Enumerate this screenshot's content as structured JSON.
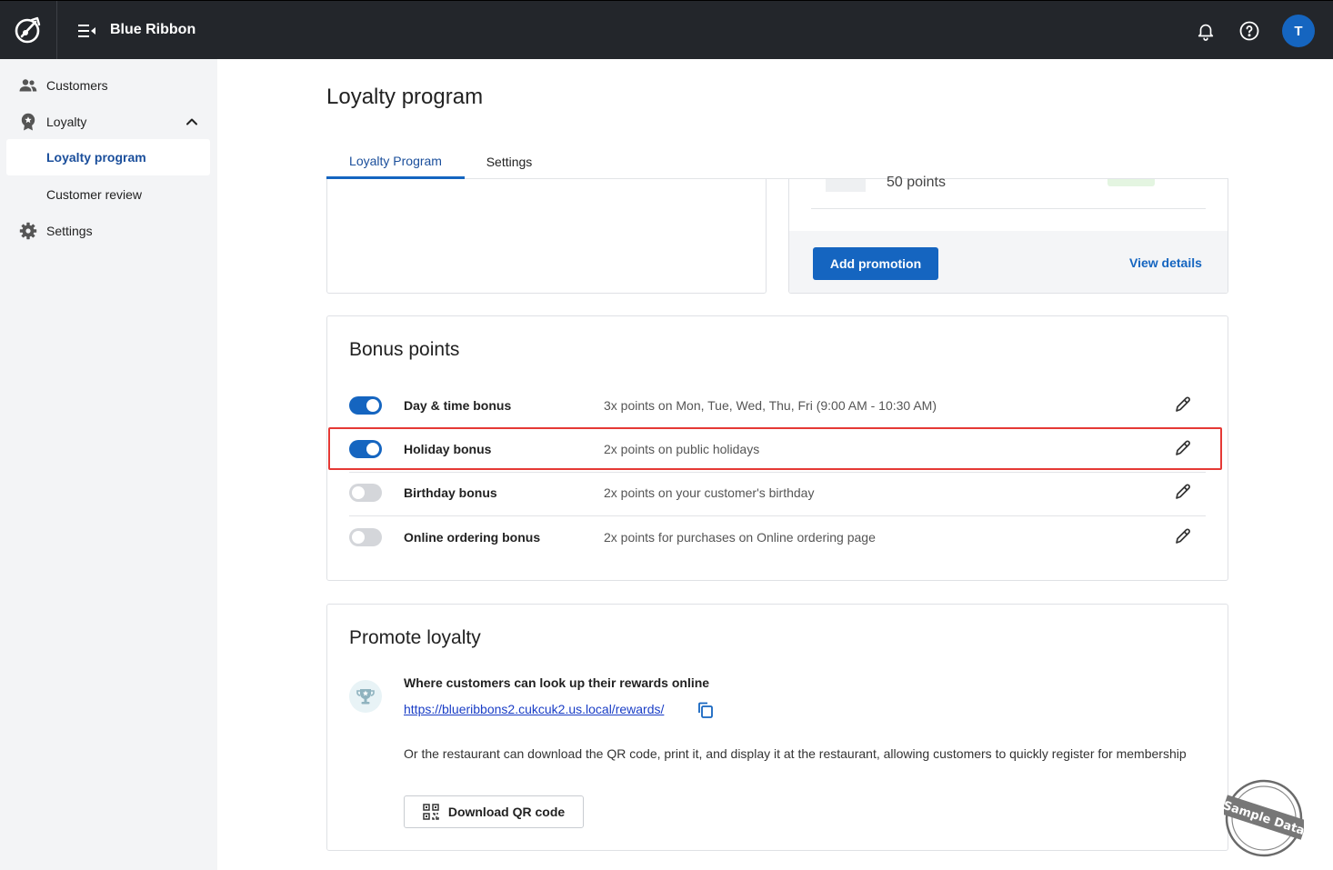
{
  "app": {
    "name": "Blue Ribbon",
    "avatar_initial": "T"
  },
  "sidebar": {
    "items": [
      {
        "label": "Customers",
        "icon": "customers-icon"
      },
      {
        "label": "Loyalty",
        "icon": "loyalty-badge-icon"
      },
      {
        "label": "Loyalty program",
        "active": true
      },
      {
        "label": "Customer review"
      },
      {
        "label": "Settings",
        "icon": "gear-icon"
      }
    ]
  },
  "page": {
    "title": "Loyalty program",
    "tabs": [
      {
        "label": "Loyalty Program",
        "active": true
      },
      {
        "label": "Settings",
        "active": false
      }
    ]
  },
  "promotions": {
    "points_text": "50 points",
    "add_label": "Add promotion",
    "view_label": "View details"
  },
  "bonus": {
    "title": "Bonus points",
    "rows": [
      {
        "name": "Day & time bonus",
        "desc": "3x points on Mon, Tue, Wed, Thu, Fri (9:00 AM - 10:30 AM)",
        "enabled": true
      },
      {
        "name": "Holiday bonus",
        "desc": "2x points on public holidays",
        "enabled": true
      },
      {
        "name": "Birthday bonus",
        "desc": "2x points on your customer's birthday",
        "enabled": false
      },
      {
        "name": "Online ordering bonus",
        "desc": "2x points for purchases on Online ordering page",
        "enabled": false
      }
    ]
  },
  "promote": {
    "title": "Promote loyalty",
    "heading": "Where customers can look up their rewards online",
    "link": "https://blueribbons2.cukcuk2.us.local/rewards/",
    "note": "Or the restaurant can download the QR code, print it, and display it at the restaurant, allowing customers to quickly register for membership",
    "qr_button": "Download QR code"
  },
  "watermark": "Sample Data",
  "colors": {
    "topbar": "#23262b",
    "accent": "#1565c0",
    "highlight": "#e53935"
  }
}
